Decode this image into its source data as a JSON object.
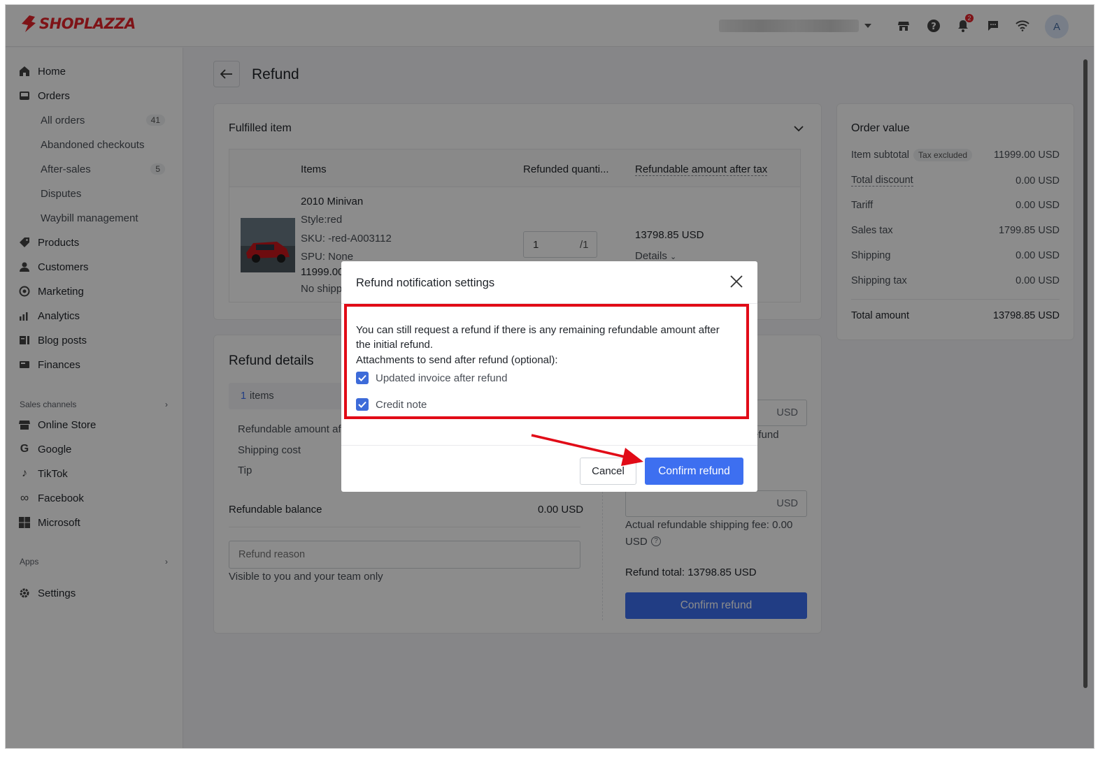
{
  "app": {
    "brand": "SHOPLAZZA",
    "avatar_letter": "A",
    "notification_count": "2"
  },
  "sidebar": {
    "home": "Home",
    "orders": "Orders",
    "orders_sub": [
      {
        "label": "All orders",
        "count": "41"
      },
      {
        "label": "Abandoned checkouts",
        "count": ""
      },
      {
        "label": "After-sales",
        "count": "5"
      },
      {
        "label": "Disputes",
        "count": ""
      },
      {
        "label": "Waybill management",
        "count": ""
      }
    ],
    "products": "Products",
    "customers": "Customers",
    "marketing": "Marketing",
    "analytics": "Analytics",
    "blog_posts": "Blog posts",
    "finances": "Finances",
    "sales_channels": "Sales channels",
    "online_store": "Online Store",
    "google": "Google",
    "tiktok": "TikTok",
    "facebook": "Facebook",
    "microsoft": "Microsoft",
    "apps": "Apps",
    "settings": "Settings"
  },
  "page": {
    "title": "Refund"
  },
  "fulfilled": {
    "title": "Fulfilled item",
    "headers": {
      "items": "Items",
      "qty": "Refunded quanti...",
      "amount": "Refundable amount after tax"
    },
    "product": {
      "name": "2010 Minivan",
      "style": "Style:red",
      "sku": "SKU: -red-A003112",
      "spu": "SPU: None",
      "price": "11999.00",
      "shipping": "No shipp",
      "qty_value": "1",
      "qty_max": "/1",
      "amount": "13798.85 USD",
      "details": "Details"
    }
  },
  "refund_details": {
    "title": "Refund details",
    "items_count": "1",
    "items_label": "items",
    "refundable_amount": "Refundable amount aft",
    "shipping_cost": "Shipping cost",
    "tip": "Tip",
    "refundable_balance_label": "Refundable balance",
    "refundable_balance_value": "0.00 USD",
    "reason_placeholder": "Refund reason",
    "reason_hint": "Visible to you and your team only",
    "usd": "USD",
    "efund_hint": "efund",
    "actual_shipping_fee_1": "Actual refundable shipping fee: 0.00",
    "actual_shipping_fee_2": "USD",
    "refund_total": "Refund total: 13798.85 USD",
    "confirm_button": "Confirm refund"
  },
  "order_value": {
    "title": "Order value",
    "rows": [
      {
        "label": "Item subtotal",
        "tag": "Tax excluded",
        "value": "11999.00 USD"
      },
      {
        "label": "Total discount",
        "value": "0.00 USD"
      },
      {
        "label": "Tariff",
        "value": "0.00 USD"
      },
      {
        "label": "Sales tax",
        "value": "1799.85 USD"
      },
      {
        "label": "Shipping",
        "value": "0.00 USD"
      },
      {
        "label": "Shipping tax",
        "value": "0.00 USD"
      }
    ],
    "total_label": "Total amount",
    "total_value": "13798.85 USD"
  },
  "modal": {
    "title": "Refund notification settings",
    "message_line1": "You can still request a refund if there is any remaining refundable amount after",
    "message_line2": "the initial refund.",
    "attachments_label": "Attachments to send after refund (optional):",
    "option1": "Updated invoice after refund",
    "option2": "Credit note",
    "cancel": "Cancel",
    "confirm": "Confirm refund"
  },
  "colors": {
    "brand": "#e6232a",
    "primary": "#3d6ff0",
    "highlight": "#e10b17"
  }
}
